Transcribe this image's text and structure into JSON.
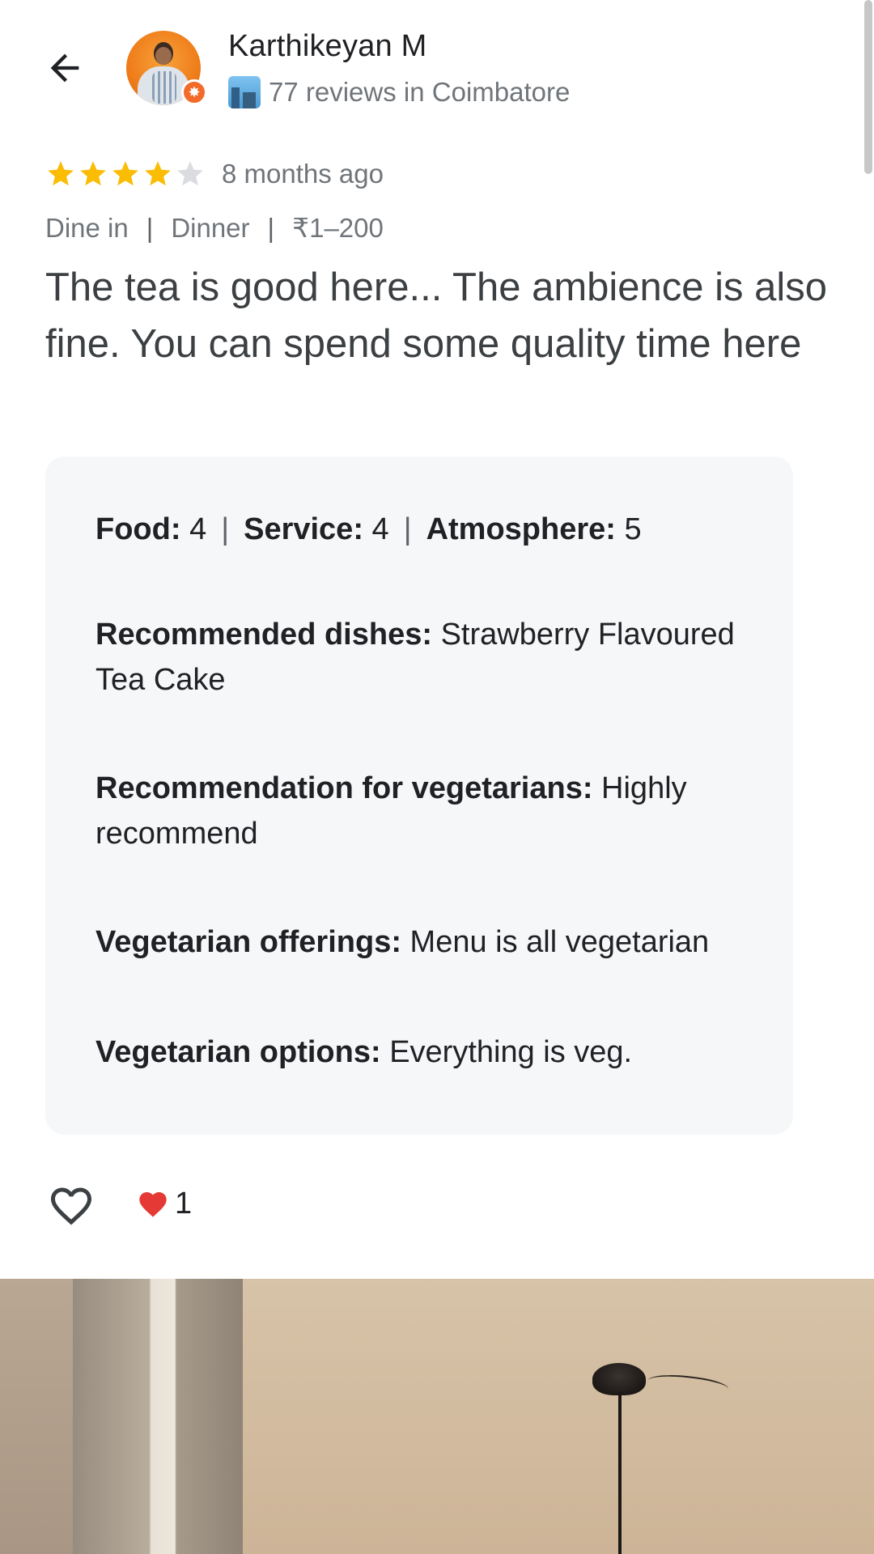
{
  "header": {
    "back_icon": "arrow-left-icon",
    "reviewer_name": "Karthikeyan M",
    "reviewer_meta": "77 reviews in Coimbatore",
    "avatar_badge_icon": "local-guide-badge-icon",
    "city_icon": "cityscape-emoji-icon"
  },
  "rating": {
    "stars": 4,
    "max": 5,
    "time_ago": "8 months ago",
    "star_color": "#fbbc04",
    "empty_star_color": "#dadce0"
  },
  "tags": {
    "service_type": "Dine in",
    "meal_type": "Dinner",
    "price": "₹1–200"
  },
  "review_text": "The tea is good here... The ambience is also fine. You can spend some quality time here",
  "details": {
    "food_label": "Food:",
    "food_value": "4",
    "service_label": "Service:",
    "service_value": "4",
    "atmosphere_label": "Atmosphere:",
    "atmosphere_value": "5",
    "recommended_dishes_label": "Recommended dishes:",
    "recommended_dishes_value": "Strawberry Flavoured Tea Cake",
    "veg_recommendation_label": "Recommendation for vegetarians:",
    "veg_recommendation_value": "Highly recommend",
    "veg_offerings_label": "Vegetarian offerings:",
    "veg_offerings_value": "Menu is all vegetarian",
    "veg_options_label": "Vegetarian options:",
    "veg_options_value": "Everything is veg."
  },
  "reactions": {
    "like_icon": "heart-outline-icon",
    "reaction_icon": "red-heart-icon",
    "reaction_count": "1"
  },
  "photo": {
    "icon": "review-photo"
  }
}
